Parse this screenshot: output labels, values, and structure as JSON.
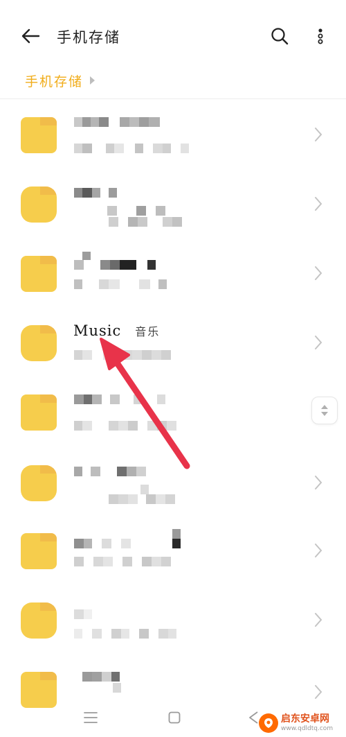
{
  "header": {
    "title": "手机存储",
    "back_icon": "arrow-left-icon",
    "search_icon": "search-icon",
    "more_icon": "more-vertical-icon"
  },
  "breadcrumb": {
    "items": [
      "手机存储"
    ],
    "color": "#f1ad1b"
  },
  "file_list": {
    "folder_color": "#f6cd4c",
    "highlight_row": {
      "name": "Music",
      "subtitle": "音乐"
    },
    "chevron_icon": "chevron-right-icon"
  },
  "scroll_handle": {
    "icon": "up-down-arrows-icon"
  },
  "annotation": {
    "color": "#e8334a",
    "icon": "red-arrow"
  },
  "navbar": {
    "menu_icon": "menu-icon",
    "home_icon": "home-square-icon",
    "back_icon": "back-triangle-icon"
  },
  "watermark": {
    "title": "启东安卓网",
    "url": "www.qdldtq.com"
  }
}
